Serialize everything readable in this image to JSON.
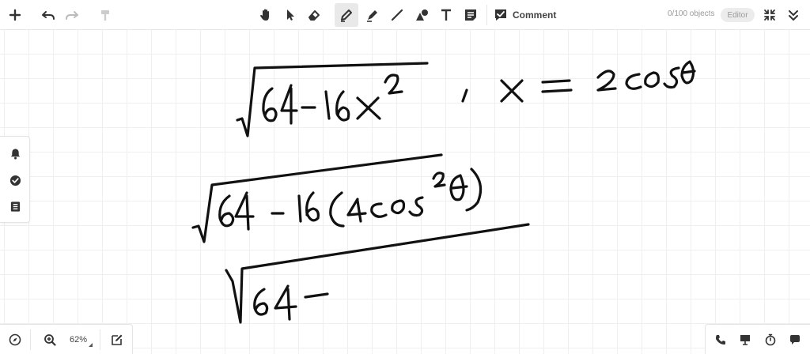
{
  "toolbar": {
    "tools": [
      {
        "name": "add",
        "icon": "plus-icon"
      },
      {
        "name": "undo",
        "icon": "undo-icon"
      },
      {
        "name": "redo",
        "icon": "redo-icon"
      },
      {
        "name": "format-painter",
        "icon": "paint-roller-icon"
      },
      {
        "name": "pan",
        "icon": "hand-icon"
      },
      {
        "name": "select",
        "icon": "cursor-icon"
      },
      {
        "name": "eraser",
        "icon": "eraser-icon"
      },
      {
        "name": "pen",
        "icon": "pen-icon",
        "active": true
      },
      {
        "name": "highlighter",
        "icon": "highlighter-icon"
      },
      {
        "name": "line",
        "icon": "line-icon"
      },
      {
        "name": "shapes",
        "icon": "shapes-icon"
      },
      {
        "name": "text",
        "icon": "text-icon"
      },
      {
        "name": "sticky-note",
        "icon": "note-icon"
      }
    ],
    "comment_label": "Comment",
    "object_count": "0/100 objects",
    "editor_label": "Editor"
  },
  "left_panel": {
    "items": [
      {
        "name": "notifications",
        "icon": "bell-icon"
      },
      {
        "name": "check",
        "icon": "check-circle-icon"
      },
      {
        "name": "pages",
        "icon": "list-icon"
      }
    ]
  },
  "bottom_left": {
    "zoom_level": "62%"
  },
  "bottom_right": {
    "items": [
      {
        "name": "call",
        "icon": "phone-icon"
      },
      {
        "name": "present",
        "icon": "presentation-icon"
      },
      {
        "name": "timer",
        "icon": "stopwatch-icon"
      },
      {
        "name": "chat",
        "icon": "chat-icon"
      }
    ]
  },
  "colors": {
    "ink": "#111111",
    "grid": "#efefef",
    "toolbar_icon": "#333333",
    "active_tool_bg": "#e9e9e9"
  }
}
